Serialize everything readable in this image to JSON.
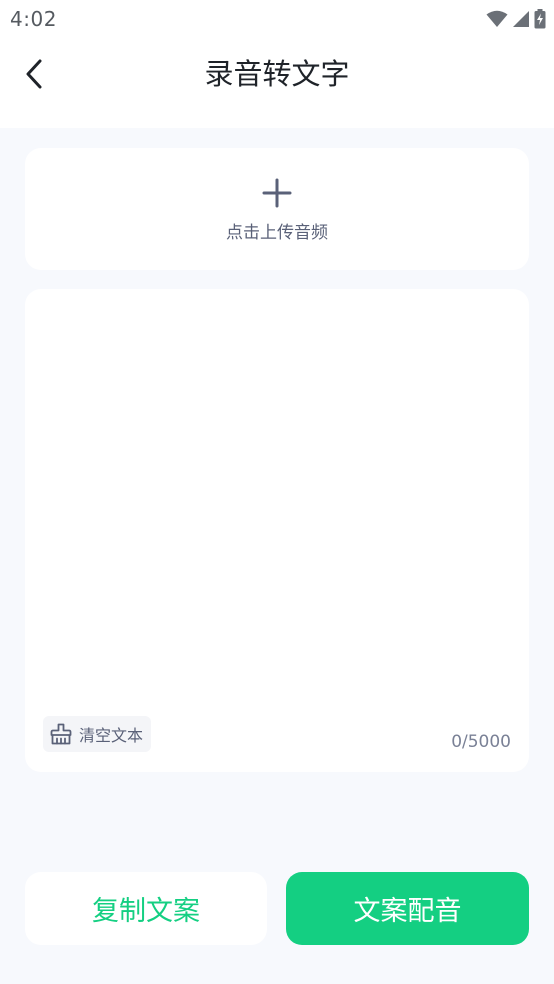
{
  "status_bar": {
    "time": "4:02",
    "icons": [
      "wifi-icon",
      "signal-icon",
      "battery-charging-icon"
    ]
  },
  "header": {
    "title": "录音转文字",
    "back_icon": "chevron-left-icon"
  },
  "upload": {
    "icon": "plus-icon",
    "label": "点击上传音频"
  },
  "editor": {
    "value": "",
    "clear_label": "清空文本",
    "clear_icon": "broom-icon",
    "char_count": "0/5000"
  },
  "actions": {
    "copy_label": "复制文案",
    "dub_label": "文案配音"
  },
  "colors": {
    "accent": "#14cf82",
    "background": "#f7f9fd",
    "card": "#ffffff",
    "muted_text": "#5a6178"
  }
}
